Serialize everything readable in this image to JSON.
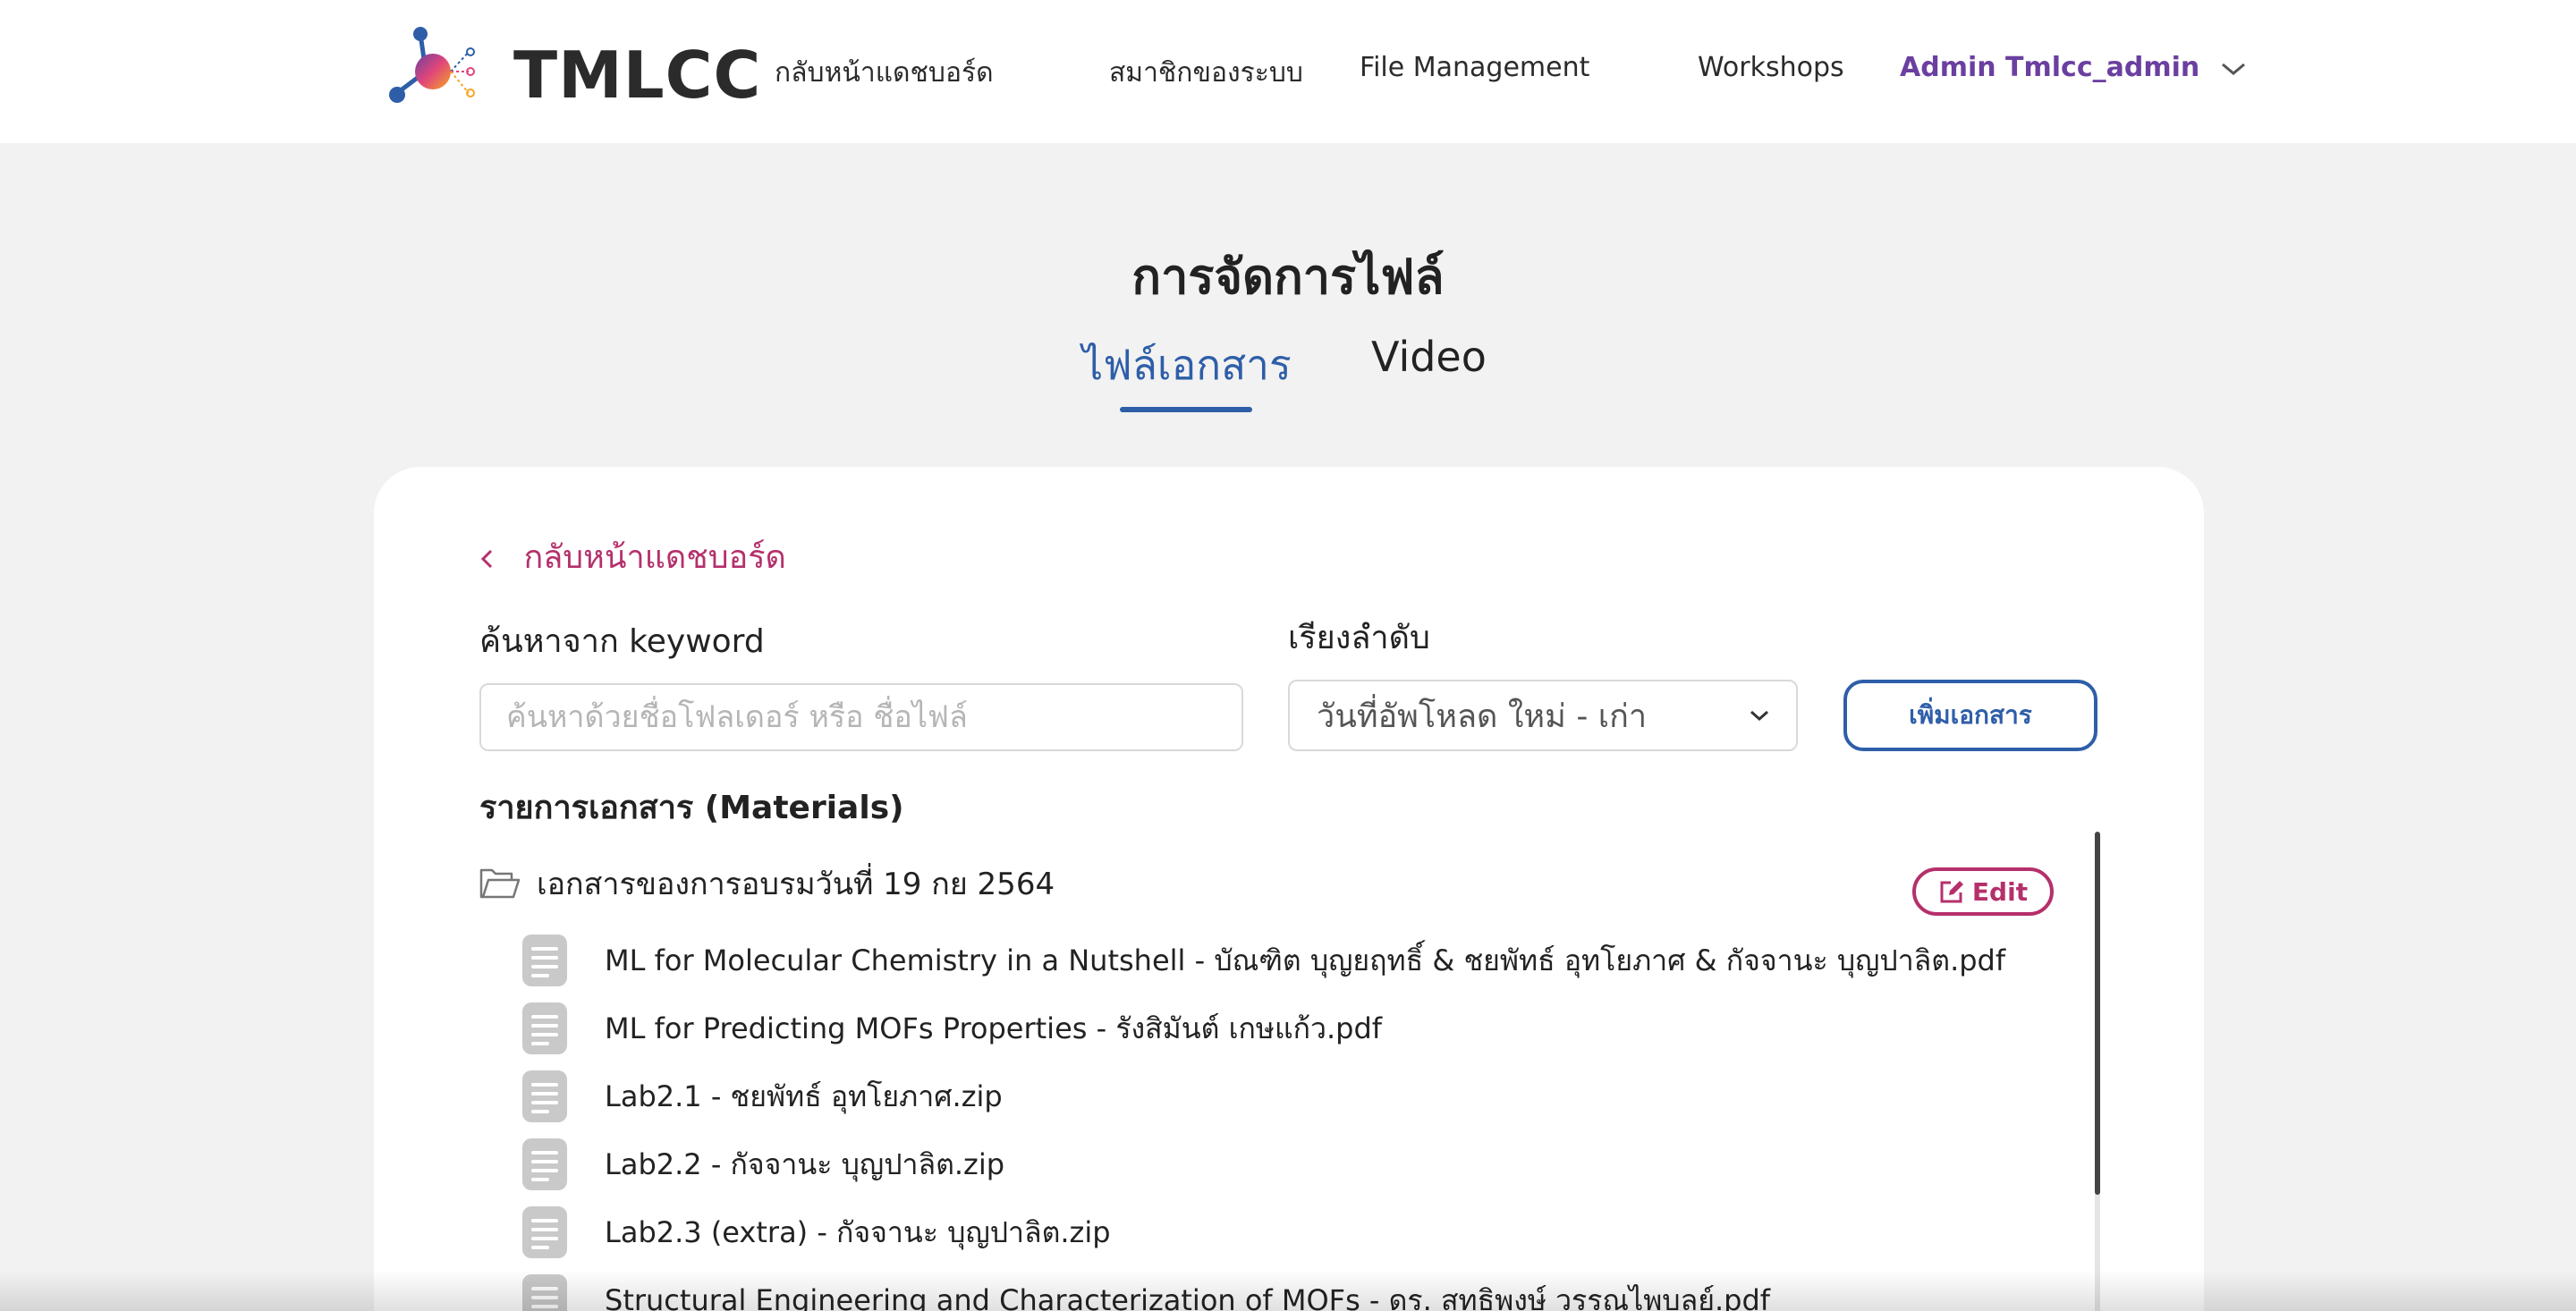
{
  "nav": {
    "logo_text": "TMLCC",
    "items": [
      {
        "label": "กลับหน้าแดชบอร์ด"
      },
      {
        "label": "สมาชิกของระบบ"
      },
      {
        "label": "File Management"
      },
      {
        "label": "Workshops"
      }
    ],
    "user_label": "Admin Tmlcc_admin"
  },
  "page": {
    "title": "การจัดการไฟล์",
    "tabs": [
      {
        "label": "ไฟล์เอกสาร",
        "active": true
      },
      {
        "label": "Video",
        "active": false
      }
    ]
  },
  "card": {
    "back_label": "กลับหน้าแดชบอร์ด",
    "search": {
      "label": "ค้นหาจาก keyword",
      "placeholder": "ค้นหาด้วยชื่อโฟลเดอร์ หรือ ชื่อไฟล์",
      "value": ""
    },
    "sort": {
      "label": "เรียงลำดับ",
      "selected": "วันที่อัพโหลด ใหม่ - เก่า"
    },
    "add_button": "เพิ่มเอกสาร",
    "section_title": "รายการเอกสาร (Materials)",
    "folder": {
      "name": "เอกสารของการอบรมวันที่ 19 กย 2564",
      "edit_label": "Edit",
      "files": [
        {
          "name": "ML for Molecular Chemistry in a Nutshell - บัณฑิต บุญยฤทธิ์ & ชยพัทธ์ อุทโยภาศ & กัจจานะ บุญปาลิต.pdf"
        },
        {
          "name": "ML for Predicting MOFs Properties - รังสิมันต์ เกษแก้ว.pdf"
        },
        {
          "name": "Lab2.1 - ชยพัทธ์ อุทโยภาศ.zip"
        },
        {
          "name": "Lab2.2 - กัจจานะ บุญปาลิต.zip"
        },
        {
          "name": "Lab2.3 (extra) - กัจจานะ บุญปาลิต.zip"
        },
        {
          "name": "Structural Engineering and Characterization of MOFs - ดร. สุทธิพงษ์ วรรณไพบูลย์.pdf"
        }
      ]
    }
  },
  "colors": {
    "accent_blue": "#2e5ea8",
    "accent_pink": "#b5306b",
    "user_purple": "#6b3fa0"
  },
  "icons": [
    "logo-molecule-icon",
    "chevron-down-icon",
    "chevron-left-icon",
    "folder-open-icon",
    "edit-icon",
    "document-icon"
  ]
}
